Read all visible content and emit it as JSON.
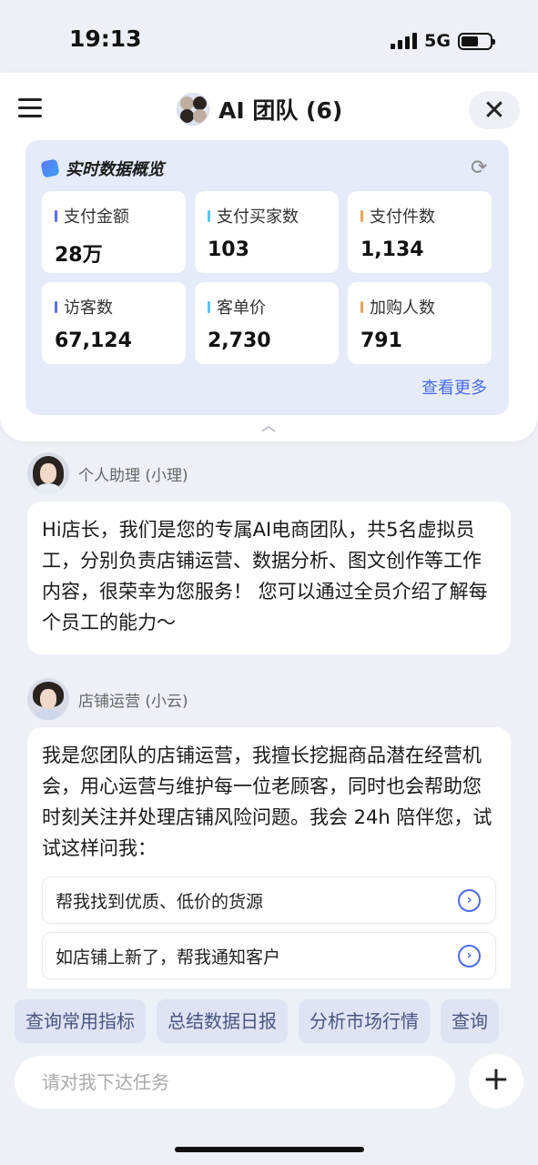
{
  "status": {
    "time": "19:13",
    "network": "5G"
  },
  "header": {
    "title": "AI 团队 (6)"
  },
  "metrics": {
    "title": "实时数据概览",
    "more": "查看更多",
    "items": [
      {
        "label": "支付金额",
        "value": "28万",
        "color": "#5b6cf0"
      },
      {
        "label": "支付买家数",
        "value": "103",
        "color": "#5bc2f0"
      },
      {
        "label": "支付件数",
        "value": "1,134",
        "color": "#f0a15b"
      },
      {
        "label": "访客数",
        "value": "67,124",
        "color": "#5b6cf0"
      },
      {
        "label": "客单价",
        "value": "2,730",
        "color": "#5bc2f0"
      },
      {
        "label": "加购人数",
        "value": "791",
        "color": "#f0a15b"
      }
    ]
  },
  "chat": {
    "messages": [
      {
        "agent": "个人助理 (小理)",
        "text": "Hi店长，我们是您的专属AI电商团队，共5名虚拟员工，分别负责店铺运营、数据分析、图文创作等工作内容，很荣幸为您服务！ 您可以通过全员介绍了解每个员工的能力～"
      },
      {
        "agent": "店铺运营 (小云)",
        "text": "我是您团队的店铺运营，我擅长挖掘商品潜在经营机会，用心运营与维护每一位老顾客，同时也会帮助您时刻关注并处理店铺风险问题。我会 24h 陪伴您，试试这样问我：",
        "suggestions": [
          "帮我找到优质、低价的货源",
          "如店铺上新了，帮我通知客户"
        ]
      }
    ]
  },
  "chips": [
    "查询常用指标",
    "总结数据日报",
    "分析市场行情",
    "查询"
  ],
  "input": {
    "placeholder": "请对我下达任务"
  }
}
